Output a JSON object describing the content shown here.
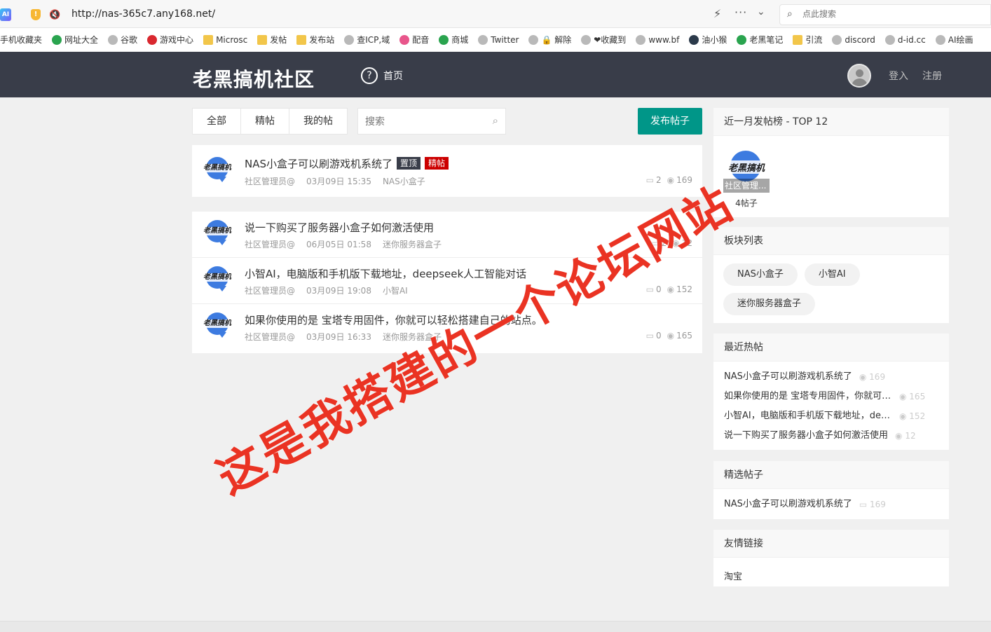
{
  "browser": {
    "logo_text": "AI",
    "url": "http://nas-365c7.any168.net/",
    "search_placeholder": "点此搜索",
    "bookmarks": [
      {
        "label": "手机收藏夹",
        "icon": "none"
      },
      {
        "label": "网址大全",
        "icon": "green"
      },
      {
        "label": "谷歌",
        "icon": "globe"
      },
      {
        "label": "游戏中心",
        "icon": "red"
      },
      {
        "label": "Microsc",
        "icon": "folder"
      },
      {
        "label": "发帖",
        "icon": "folder"
      },
      {
        "label": "发布站",
        "icon": "folder"
      },
      {
        "label": "查ICP,域",
        "icon": "globe"
      },
      {
        "label": "配音",
        "icon": "pink"
      },
      {
        "label": "商城",
        "icon": "green"
      },
      {
        "label": "Twitter",
        "icon": "globe"
      },
      {
        "label": "🔒 解除",
        "icon": "globe"
      },
      {
        "label": "❤收藏到",
        "icon": "globe"
      },
      {
        "label": "www.bf",
        "icon": "globe"
      },
      {
        "label": "油小猴",
        "icon": "dark"
      },
      {
        "label": "老黑笔记",
        "icon": "green"
      },
      {
        "label": "引流",
        "icon": "folder"
      },
      {
        "label": "discord",
        "icon": "globe"
      },
      {
        "label": "d-id.cc",
        "icon": "globe"
      },
      {
        "label": "AI绘画",
        "icon": "globe"
      }
    ]
  },
  "header": {
    "logo": "老黑搞机社区",
    "home": "首页",
    "login": "登入",
    "register": "注册"
  },
  "controls": {
    "tabs": [
      "全部",
      "精帖",
      "我的帖"
    ],
    "search_placeholder": "搜索",
    "publish": "发布帖子"
  },
  "avatar_text": "老黑搞机",
  "pinned_posts": [
    {
      "title": "NAS小盒子可以刷游戏机系统了",
      "badges": [
        "置顶",
        "精帖"
      ],
      "author": "社区管理员@",
      "date": "03月09日 15:35",
      "board": "NAS小盒子",
      "comments": "2",
      "views": "169"
    }
  ],
  "posts": [
    {
      "title": "说一下购买了服务器小盒子如何激活使用",
      "author": "社区管理员@",
      "date": "06月05日 01:58",
      "board": "迷你服务器盒子",
      "comments": "2",
      "views": "12"
    },
    {
      "title": "小智AI，电脑版和手机版下载地址，deepseek人工智能对话",
      "author": "社区管理员@",
      "date": "03月09日 19:08",
      "board": "小智AI",
      "comments": "0",
      "views": "152"
    },
    {
      "title": "如果你使用的是 宝塔专用固件，你就可以轻松搭建自己的站点。",
      "author": "社区管理员@",
      "date": "03月09日 16:33",
      "board": "迷你服务器盒子",
      "comments": "0",
      "views": "165"
    }
  ],
  "sidebar": {
    "rank_title": "近一月发帖榜 - TOP 12",
    "rank_user": {
      "name": "社区管理...",
      "count": "4帖子"
    },
    "boards_title": "板块列表",
    "boards": [
      "NAS小盒子",
      "小智AI",
      "迷你服务器盒子"
    ],
    "hot_title": "最近热帖",
    "hot": [
      {
        "title": "NAS小盒子可以刷游戏机系统了",
        "views": "169"
      },
      {
        "title": "如果你使用的是 宝塔专用固件，你就可以轻松搭建自己的站点。",
        "views": "165"
      },
      {
        "title": "小智AI，电脑版和手机版下载地址，deepseek人工智能对话",
        "views": "152"
      },
      {
        "title": "说一下购买了服务器小盒子如何激活使用",
        "views": "12"
      }
    ],
    "featured_title": "精选帖子",
    "featured": [
      {
        "title": "NAS小盒子可以刷游戏机系统了",
        "comments": "169"
      }
    ],
    "links_title": "友情链接",
    "links": [
      "淘宝"
    ]
  },
  "overlay": "这是我搭建的一个论坛网站"
}
